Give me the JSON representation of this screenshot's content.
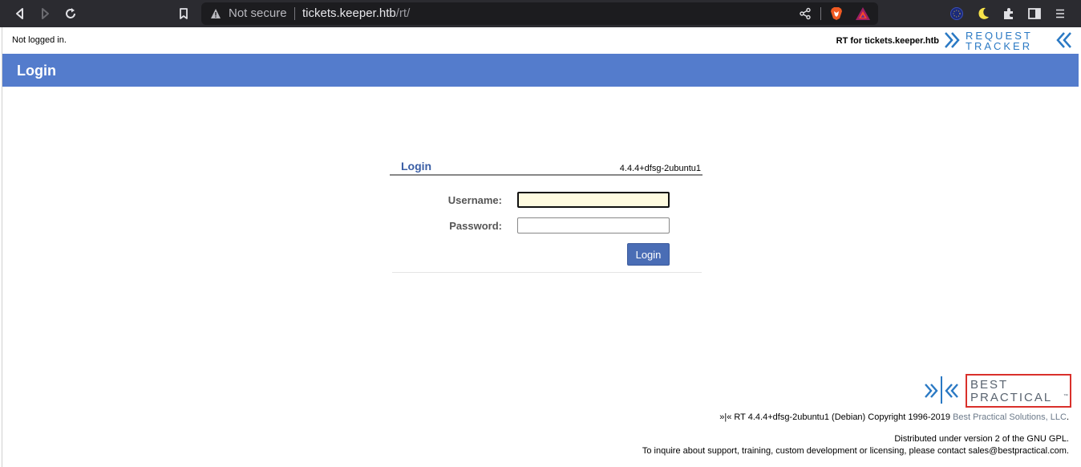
{
  "browser": {
    "security_text": "Not secure",
    "url_host": "tickets.keeper.htb",
    "url_path": "/rt/"
  },
  "topbar": {
    "status": "Not logged in.",
    "site_name": "RT for tickets.keeper.htb",
    "logo_line1": "REQUEST",
    "logo_line2": "TRACKER"
  },
  "header": {
    "title": "Login"
  },
  "login": {
    "box_title": "Login",
    "version": "4.4.4+dfsg-2ubuntu1",
    "username_label": "Username:",
    "password_label": "Password:",
    "username_value": "",
    "password_value": "",
    "submit_label": "Login"
  },
  "footer": {
    "bp_logo_line1": "BEST",
    "bp_logo_line2": "PRACTICAL",
    "bp_logo_tm": "™",
    "copyright_prefix": "»|« RT 4.4.4+dfsg-2ubuntu1 (Debian) Copyright 1996-2019 ",
    "copyright_link": "Best Practical Solutions, LLC",
    "copyright_suffix": ".",
    "gpl": "Distributed under version 2 of the GNU GPL.",
    "contact": "To inquire about support, training, custom development or licensing, please contact sales@bestpractical.com."
  },
  "colors": {
    "header_band": "#547ccc",
    "login_title": "#3a5ea5",
    "button": "#4a6db5",
    "logo_blue": "#2a79c4",
    "bp_red": "#d9302b"
  },
  "icons": [
    "back-icon",
    "forward-icon",
    "reload-icon",
    "bookmark-icon",
    "warning-icon",
    "share-icon",
    "brave-shield-icon",
    "bat-rewards-icon",
    "vpn-globe-icon",
    "dark-mode-icon",
    "extensions-icon",
    "sidebar-icon",
    "menu-icon"
  ]
}
